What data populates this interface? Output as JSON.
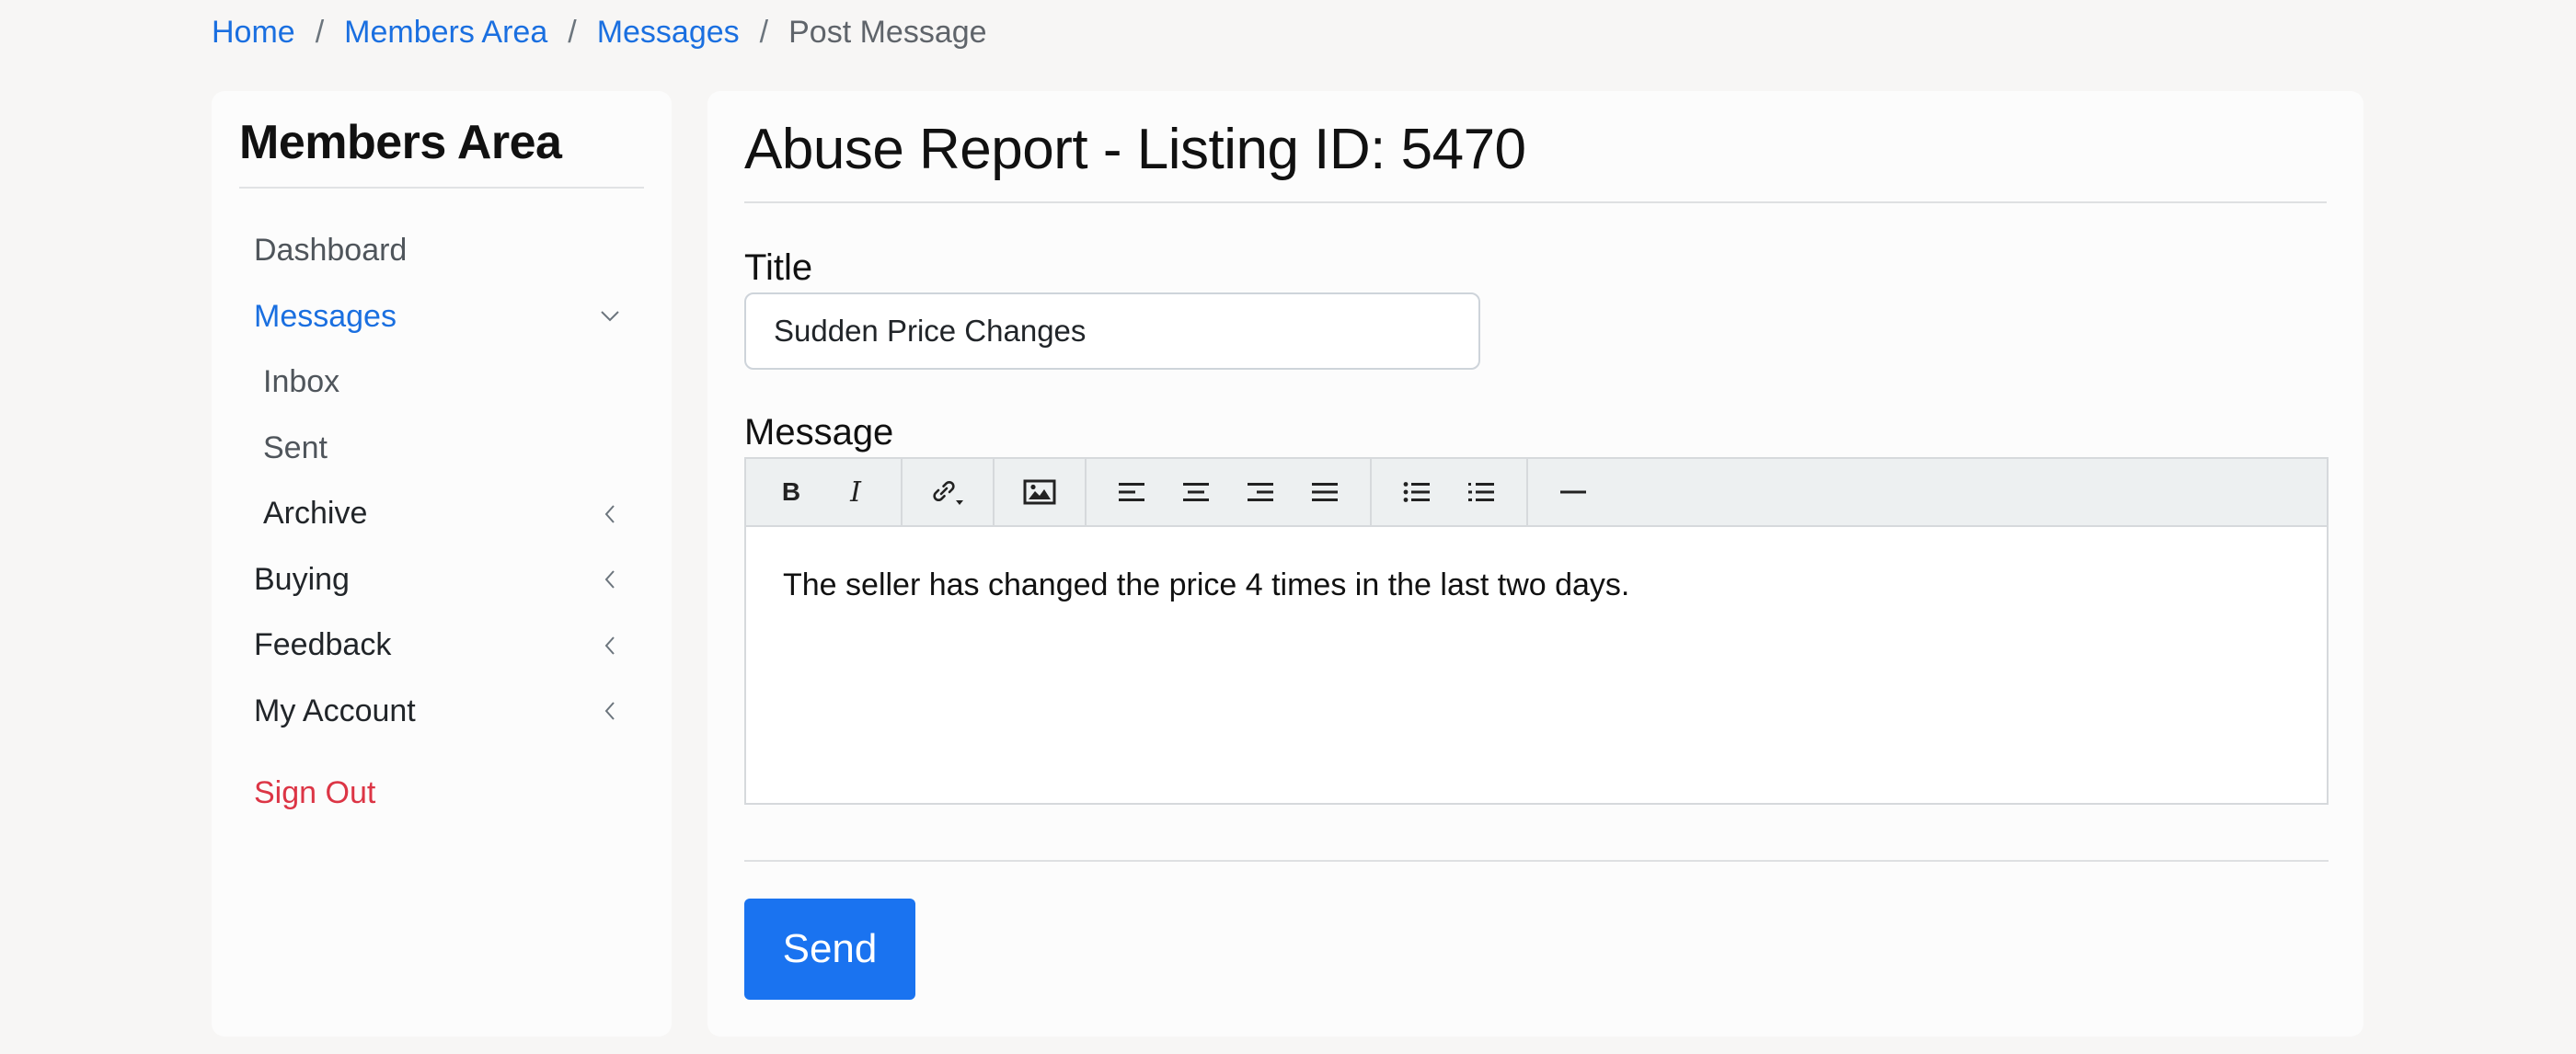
{
  "breadcrumb": [
    {
      "label": "Home",
      "link": true
    },
    {
      "label": "Members Area",
      "link": true
    },
    {
      "label": "Messages",
      "link": true
    },
    {
      "label": "Post Message",
      "link": false
    }
  ],
  "sidebar": {
    "title": "Members Area",
    "items": [
      {
        "label": "Dashboard"
      },
      {
        "label": "Messages",
        "icon": "chevron-down-icon"
      },
      {
        "label": "Inbox"
      },
      {
        "label": "Sent"
      },
      {
        "label": "Archive",
        "icon": "chevron-left-icon"
      },
      {
        "label": "Buying",
        "icon": "chevron-left-icon"
      },
      {
        "label": "Feedback",
        "icon": "chevron-left-icon"
      },
      {
        "label": "My Account",
        "icon": "chevron-left-icon"
      }
    ],
    "signout": "Sign Out"
  },
  "main": {
    "heading": "Abuse Report - Listing ID: 5470",
    "title_label": "Title",
    "title_value": "Sudden Price Changes",
    "message_label": "Message",
    "toolbar": {
      "bold": "B",
      "italic": "I"
    },
    "message_body": "The seller has changed the price 4 times in the last two days.",
    "send_label": "Send"
  },
  "colors": {
    "link": "#1a6fe0",
    "signout": "#dc3545",
    "primary_button": "#1a73f0",
    "page_background": "#f7f6f5"
  }
}
